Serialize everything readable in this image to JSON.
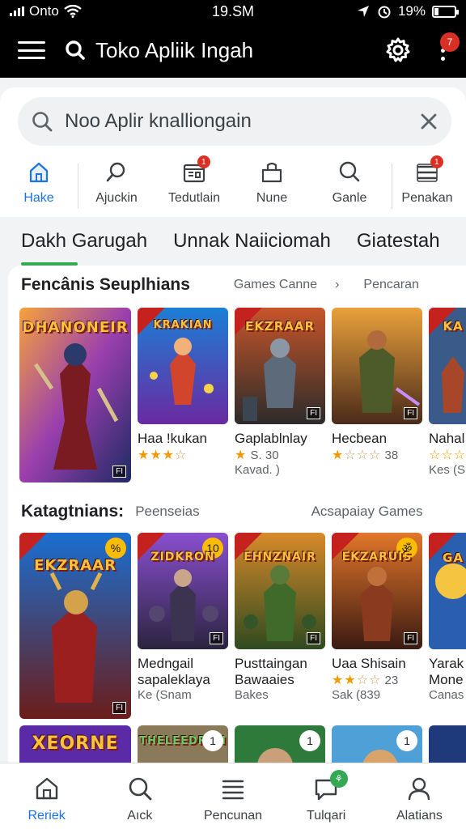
{
  "status_bar": {
    "carrier": "Onto",
    "time": "19.SM",
    "battery": "19%",
    "battery_level": 0.19
  },
  "app_bar": {
    "title": "Toko Apliik Ingah",
    "notification_count": "7"
  },
  "search": {
    "placeholder": "Noo Aplir knalliongain"
  },
  "quick_actions": [
    {
      "label": "Hake",
      "icon": "home-icon",
      "active": true
    },
    {
      "label": "Ajuckin",
      "icon": "search-icon"
    },
    {
      "label": "Tedutlain",
      "icon": "calendar-icon",
      "badge": "1"
    },
    {
      "label": "Nune",
      "icon": "bag-icon"
    },
    {
      "label": "Ganle",
      "icon": "search-icon"
    },
    {
      "label": "Penakan",
      "icon": "list-icon",
      "badge": "1"
    }
  ],
  "tabs": [
    {
      "label": "Dakh Garugah",
      "active": true
    },
    {
      "label": "Unnak Naiiciomah"
    },
    {
      "label": "Giatestah"
    }
  ],
  "section1": {
    "title": "Fencânis Seuplhians",
    "link1": "Games Canne",
    "chevron": "›",
    "link2": "Pencaran",
    "cards": [
      {
        "cover_title": "DHANONEIR",
        "name": "",
        "stars": 0,
        "line": ""
      },
      {
        "cover_title": "KRAKIAN",
        "name": "Haa !kukan",
        "stars": 3,
        "line": ""
      },
      {
        "cover_title": "EKZRAAR",
        "name": "Gaplablnlay",
        "stars": 1,
        "rating": "S. 30",
        "line": "Kavad.  )"
      },
      {
        "cover_title": "",
        "name": "Hecbean",
        "stars": 1,
        "rating": "38",
        "line": ""
      },
      {
        "cover_title": "KA",
        "name": "Nahal",
        "stars": 2,
        "line": "Kes (S"
      }
    ]
  },
  "section2": {
    "title": "Katagtnians:",
    "subtitle": "Peenseias",
    "link": "Acsapaiay Games",
    "cards": [
      {
        "cover_title": "EKZRAAR",
        "badge": "%",
        "name": "",
        "line": ""
      },
      {
        "cover_title": "ZIDKRON",
        "badge": "10",
        "name": "Medngail",
        "name2": "sapaleklaya",
        "line": "Ke (Snam"
      },
      {
        "cover_title": "EHNZNAIR",
        "name": "Pusttaingan",
        "name2": "Bawaaies",
        "line": "Bakes"
      },
      {
        "cover_title": "EKZARUIS",
        "badge": "ॐ",
        "name": "Uaa Shisain",
        "stars": 2,
        "rating": "23",
        "line": "Sak (839"
      },
      {
        "cover_title": "GA",
        "name": "Yarak",
        "name2": "Mone",
        "line": "Canas"
      }
    ]
  },
  "section3": {
    "cards": [
      {
        "cover_title": "XEORNE",
        "badge": ""
      },
      {
        "cover_title": "THELEEDRON",
        "badge": "1"
      },
      {
        "cover_title": "",
        "badge": "1"
      },
      {
        "cover_title": "",
        "badge": "1"
      },
      {
        "cover_title": "",
        "badge": ""
      }
    ]
  },
  "bottom_nav": [
    {
      "label": "Reriek",
      "icon": "home-icon",
      "active": true
    },
    {
      "label": "Aıck",
      "icon": "search-icon"
    },
    {
      "label": "Pencunan",
      "icon": "list-icon"
    },
    {
      "label": "Tulqari",
      "icon": "chat-icon",
      "badge": "⚘"
    },
    {
      "label": "Alatians",
      "icon": "person-icon"
    }
  ],
  "colors": {
    "accent": "#1a73e8",
    "tab_indicator": "#34a853",
    "badge_red": "#d93025",
    "star": "#f29900"
  }
}
